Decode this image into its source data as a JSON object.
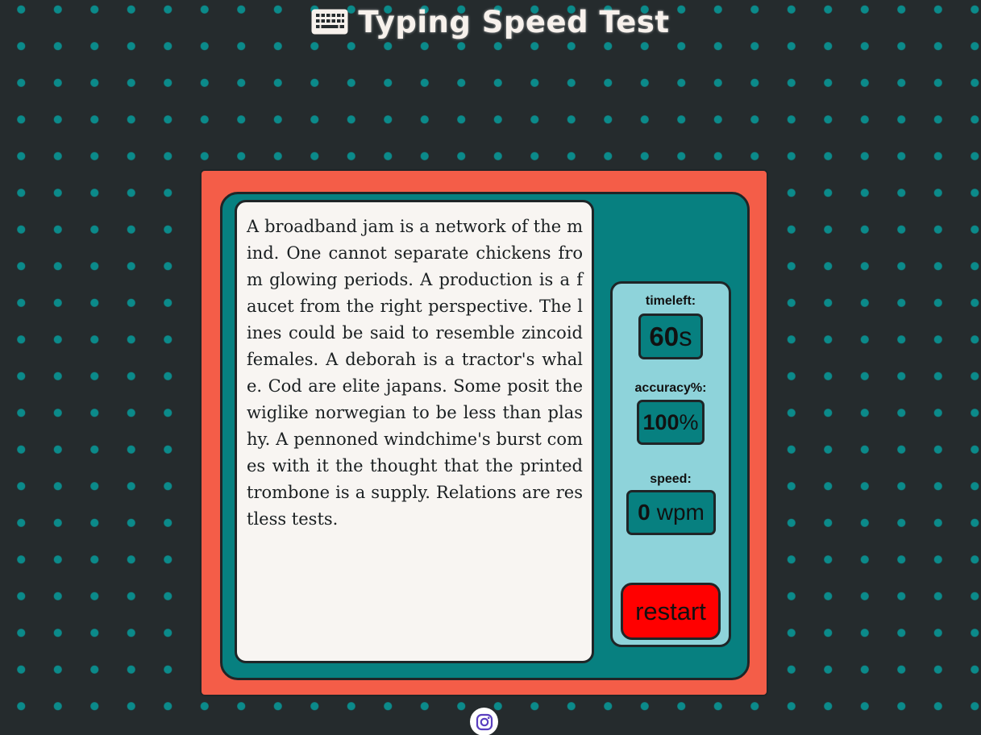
{
  "header": {
    "title": "Typing Speed Test",
    "icon": "keyboard-icon"
  },
  "passage": {
    "text": "A broadband jam is a network of the mind. One cannot separate chickens from glowing periods. A production is a faucet from the right perspective. The lines could be said to resemble zincoid females. A deborah is a tractor's whale. Cod are elite japans. Some posit the wiglike norwegian to be less than plashy. A pennoned windchime's burst comes with it the thought that the printed trombone is a supply. Relations are restless tests."
  },
  "stats": {
    "timeleft": {
      "label": "timeleft:",
      "value": "60",
      "unit": "s"
    },
    "accuracy": {
      "label": "accuracy%:",
      "value": "100",
      "unit": "%"
    },
    "speed": {
      "label": "speed:",
      "value": "0",
      "unit": "wpm"
    },
    "restart_label": "restart"
  },
  "footer": {
    "icon": "instagram-icon"
  },
  "colors": {
    "background": "#252b2d",
    "dots": "#0b8a8a",
    "outer_frame": "#f45d48",
    "inner_panel": "#078080",
    "text_area": "#f8f5f2",
    "stats_panel": "#8ed3da",
    "restart_button": "#ff0000"
  }
}
